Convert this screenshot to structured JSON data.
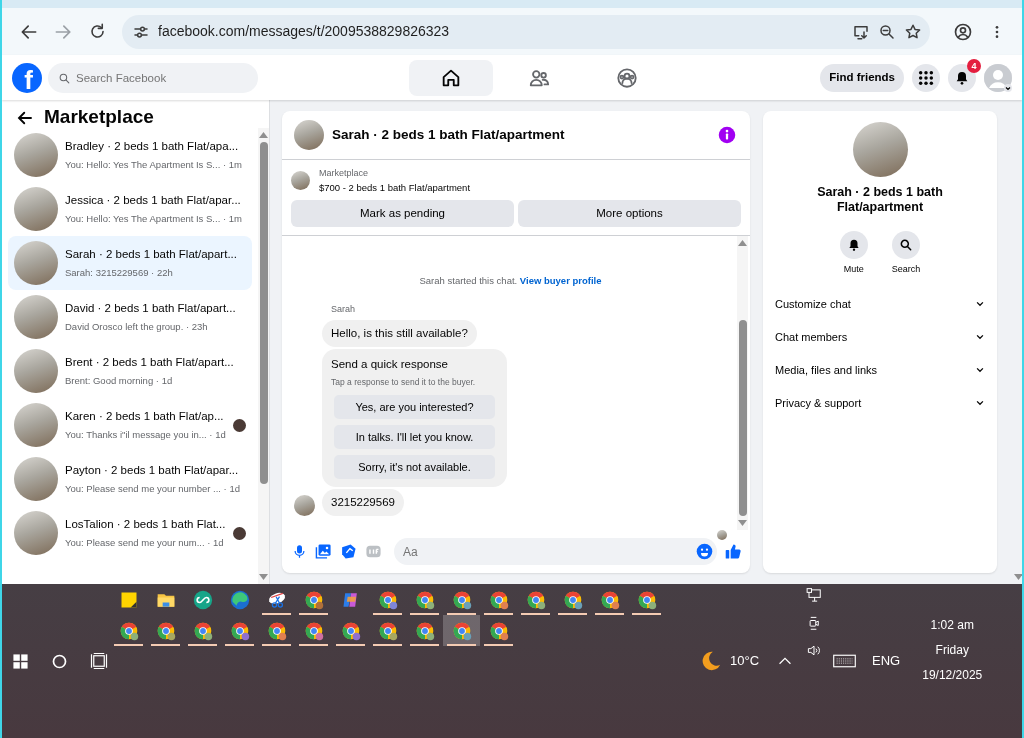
{
  "browser": {
    "url": "facebook.com/messages/t/2009538829826323"
  },
  "header": {
    "logo": "f",
    "search": {
      "placeholder": "Search Facebook"
    },
    "nav": [
      {
        "kind": "home",
        "selected": true
      },
      {
        "kind": "friends",
        "selected": false
      },
      {
        "kind": "groups",
        "selected": false
      }
    ],
    "find_friends": "Find friends",
    "notifications_badge": "4"
  },
  "sidebar": {
    "title": "Marketplace",
    "conversations": [
      {
        "title": "Bradley · 2 beds 1 bath Flat/apa...",
        "preview": "You: Hello: Yes The Apartment Is S... · 1m",
        "selected": false,
        "seen": false
      },
      {
        "title": "Jessica · 2 beds 1 bath Flat/apar...",
        "preview": "You: Hello: Yes The Apartment Is S... · 1m",
        "selected": false,
        "seen": false
      },
      {
        "title": "Sarah · 2 beds 1 bath Flat/apart...",
        "preview": "Sarah: 3215229569 · 22h",
        "selected": true,
        "seen": false
      },
      {
        "title": "David · 2 beds 1 bath Flat/apart...",
        "preview": "David Orosco left the group. · 23h",
        "selected": false,
        "seen": false
      },
      {
        "title": "Brent · 2 beds 1 bath Flat/apart...",
        "preview": "Brent: Good morning · 1d",
        "selected": false,
        "seen": false
      },
      {
        "title": "Karen · 2 beds 1 bath Flat/ap...",
        "preview": "You: Thanks i\"il message you in... · 1d",
        "selected": false,
        "seen": true
      },
      {
        "title": "Payton · 2 beds 1 bath Flat/apar...",
        "preview": "You: Please send me your number ... · 1d",
        "selected": false,
        "seen": false
      },
      {
        "title": "LosTalion · 2 beds 1 bath Flat...",
        "preview": "You: Please send me your num... · 1d",
        "selected": false,
        "seen": true
      }
    ]
  },
  "chat": {
    "title": "Sarah · 2 beds 1 bath Flat/apartment",
    "listing": {
      "label": "Marketplace",
      "text": "$700 - 2 beds 1 bath Flat/apartment"
    },
    "actions": [
      "Mark as pending",
      "More options"
    ],
    "notice": {
      "text": "Sarah started this chat.",
      "link": "View buyer profile"
    },
    "messages": [
      {
        "kind": "sender",
        "text": "Sarah"
      },
      {
        "kind": "text",
        "text": "Hello, is this still available?",
        "avatar": false
      },
      {
        "kind": "quick",
        "title": "Send a quick response",
        "subtitle": "Tap a response to send it to the buyer.",
        "options": [
          "Yes, are you interested?",
          "In talks. I'll let you know.",
          "Sorry, it's not available."
        ]
      },
      {
        "kind": "text",
        "text": "3215229569",
        "avatar": true
      }
    ],
    "composer": {
      "placeholder": "Aa"
    }
  },
  "details": {
    "title": "Sarah · 2 beds 1 bath Flat/apartment",
    "actions": [
      {
        "kind": "bell",
        "label": "Mute"
      },
      {
        "kind": "search",
        "label": "Search"
      }
    ],
    "sections": [
      "Customize chat",
      "Chat members",
      "Media, files and links",
      "Privacy & support"
    ]
  },
  "taskbar": {
    "apps": [
      {
        "kind": "sticky",
        "running": false,
        "selected": false
      },
      {
        "kind": "folder",
        "running": false,
        "selected": false
      },
      {
        "kind": "loop",
        "running": false,
        "selected": false
      },
      {
        "kind": "swirl",
        "running": false,
        "selected": false
      },
      {
        "kind": "scissors",
        "running": true,
        "selected": false
      },
      {
        "kind": "browser",
        "running": true,
        "selected": false,
        "color": "#b0703a"
      },
      {
        "kind": "ribbon",
        "running": false,
        "selected": false
      },
      {
        "kind": "browser",
        "running": true,
        "selected": false,
        "color": "#7f86d8"
      },
      {
        "kind": "browser",
        "running": true,
        "selected": false,
        "color": "#8db07a"
      },
      {
        "kind": "browser",
        "running": true,
        "selected": false,
        "color": "#6aa0b8"
      },
      {
        "kind": "browser",
        "running": true,
        "selected": false,
        "color": "#e08050"
      },
      {
        "kind": "browser",
        "running": true,
        "selected": false,
        "color": "#8db07a"
      },
      {
        "kind": "browser",
        "running": true,
        "selected": false,
        "color": "#6aa0b8"
      },
      {
        "kind": "browser",
        "running": true,
        "selected": false,
        "color": "#e08050"
      },
      {
        "kind": "browser",
        "running": true,
        "selected": false,
        "color": "#8db07a"
      },
      {
        "kind": "browser",
        "running": true,
        "selected": false,
        "color": "#8db07a"
      },
      {
        "kind": "browser",
        "running": true,
        "selected": false,
        "color": "#a8a860"
      },
      {
        "kind": "browser",
        "running": true,
        "selected": false,
        "color": "#8db07a"
      },
      {
        "kind": "browser",
        "running": true,
        "selected": false,
        "color": "#9070d0"
      },
      {
        "kind": "browser",
        "running": true,
        "selected": false,
        "color": "#e08050"
      },
      {
        "kind": "browser",
        "running": true,
        "selected": false,
        "color": "#d070a0"
      },
      {
        "kind": "browser",
        "running": true,
        "selected": false,
        "color": "#9070d0"
      },
      {
        "kind": "browser",
        "running": true,
        "selected": false,
        "color": "#a8a860"
      },
      {
        "kind": "browser",
        "running": true,
        "selected": false,
        "color": "#8db07a"
      },
      {
        "kind": "browser",
        "running": true,
        "selected": true,
        "color": "#6aa0b8"
      },
      {
        "kind": "browser",
        "running": true,
        "selected": false,
        "color": "#e08050"
      }
    ],
    "temperature": "10°C",
    "language": "ENG",
    "time": "1:02 am",
    "day": "Friday",
    "date": "19/12/2025"
  }
}
